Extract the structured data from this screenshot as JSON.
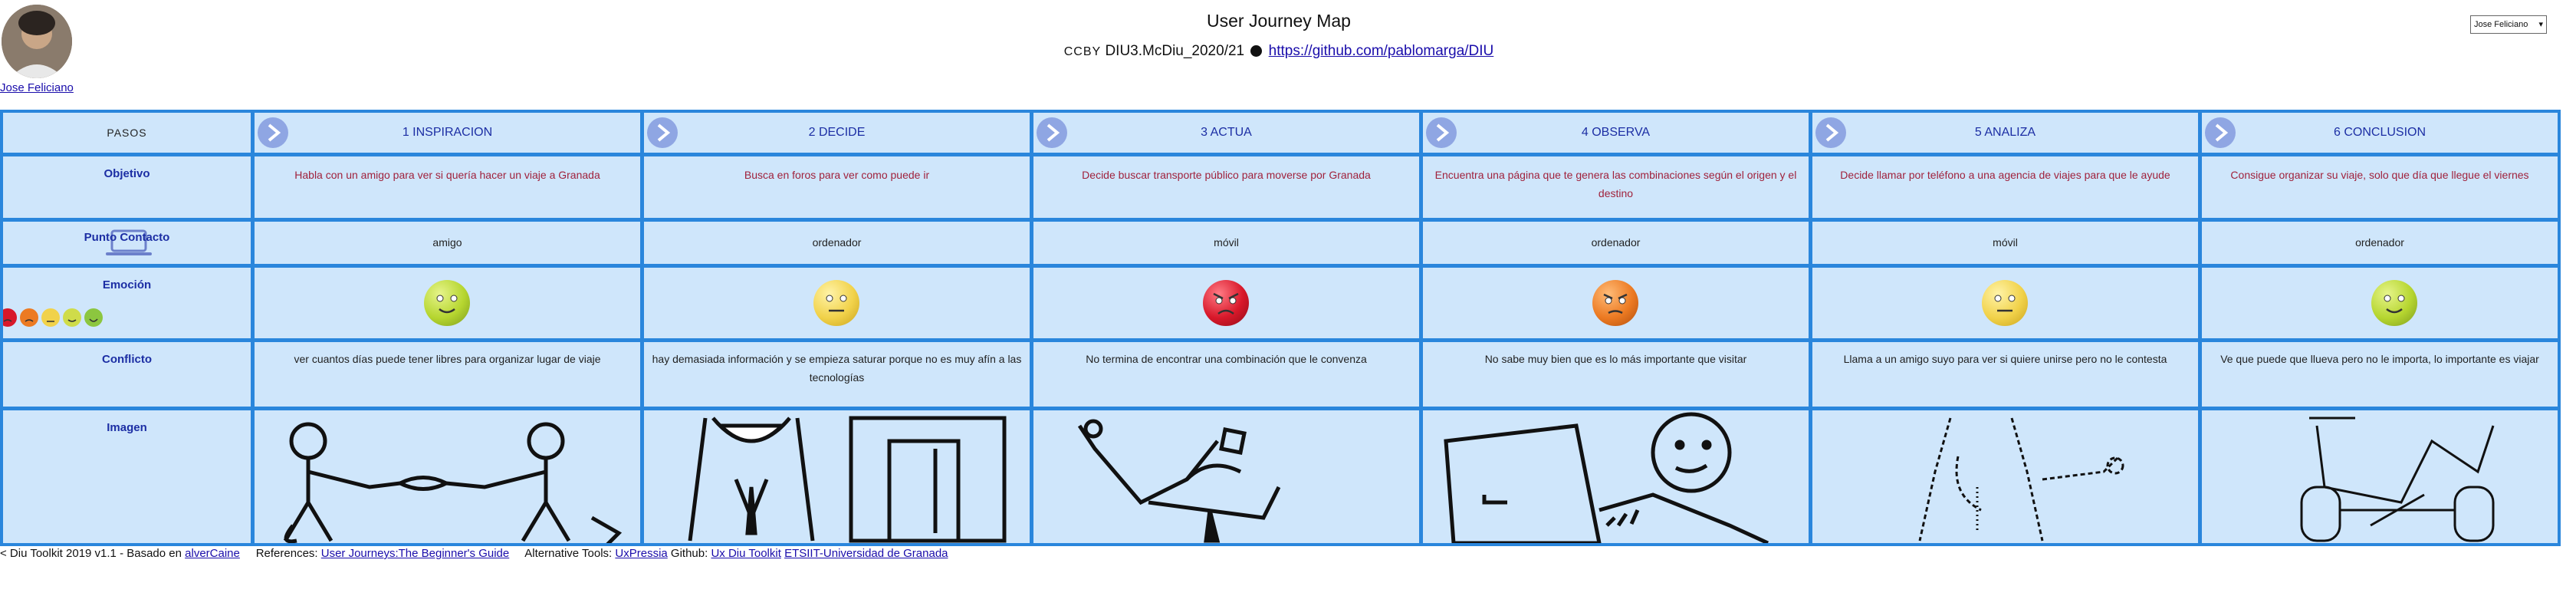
{
  "header": {
    "title": "User Journey Map",
    "cc": "CCBY",
    "course": "DIU3.McDiu_2020/21",
    "repo": "https://github.com/pablomarga/DIU",
    "user_name": "Jose Feliciano",
    "user_select": "Jose Feliciano"
  },
  "rows": {
    "pasos": "PASOS",
    "objetivo": "Objetivo",
    "punto": "Punto Contacto",
    "emocion": "Emoción",
    "conflicto": "Conflicto",
    "imagen": "Imagen"
  },
  "emotion_legend": [
    "very-angry",
    "angry",
    "neutral",
    "happy",
    "very-happy"
  ],
  "steps": [
    {
      "title": "1 INSPIRACION",
      "objetivo": "Habla con un amigo para ver si quería hacer un viaje a Granada",
      "contacto": "amigo",
      "emotion": "happy",
      "emotion_color": "#b6d630",
      "conflicto": "ver cuantos días puede tener libres para organizar lugar de viaje",
      "image": "handshake-sketch"
    },
    {
      "title": "2 DECIDE",
      "objetivo": "Busca en foros para ver como puede ir",
      "contacto": "ordenador",
      "emotion": "neutral",
      "emotion_color": "#f1d24a",
      "conflicto": "hay demasiada información y se empieza saturar porque no es muy afín a las tecnologías",
      "image": "door-sketch"
    },
    {
      "title": "3 ACTUA",
      "objetivo": "Decide buscar transporte público para moverse por Granada",
      "contacto": "móvil",
      "emotion": "very-angry",
      "emotion_color": "#d8182a",
      "conflicto": "No termina de encontrar una combinación que le convenza",
      "image": "phone-sketch"
    },
    {
      "title": "4 OBSERVA",
      "objetivo": "Encuentra una página que te genera las combinaciones según el origen y el destino",
      "contacto": "ordenador",
      "emotion": "angry",
      "emotion_color": "#ec7a22",
      "conflicto": "No sabe muy bien que es lo más importante que visitar",
      "image": "laptop-sketch"
    },
    {
      "title": "5 ANALIZA",
      "objetivo": "Decide llamar por teléfono a una agencia de viajes para que le ayude",
      "contacto": "móvil",
      "emotion": "neutral",
      "emotion_color": "#f1d24a",
      "conflicto": "Llama a un amigo suyo para ver si quiere unirse pero no le contesta",
      "image": "call-sketch"
    },
    {
      "title": "6 CONCLUSION",
      "objetivo": "Consigue organizar su viaje, solo que día que llegue el viernes",
      "contacto": "ordenador",
      "emotion": "happy",
      "emotion_color": "#b6d630",
      "conflicto": "Ve que puede que llueva pero no le importa, lo importante es viajar",
      "image": "car-sketch"
    }
  ],
  "footer": {
    "prefix": "< Diu Toolkit 2019 v1.1 - Basado en",
    "based_link": "alverCaine",
    "refs_label": "References:",
    "refs_link": "User Journeys:The Beginner's Guide",
    "alt_label": "Alternative Tools:",
    "alt_link": "UxPressia",
    "github_label": "Github:",
    "github_link": "Ux Diu Toolkit",
    "etsiit_link": "ETSIIT-Universidad de Granada"
  },
  "colors": {
    "accent": "#2a86dc",
    "cell": "#cfe6fb",
    "label": "#1c2ea4",
    "objective_text": "#a0223c"
  }
}
